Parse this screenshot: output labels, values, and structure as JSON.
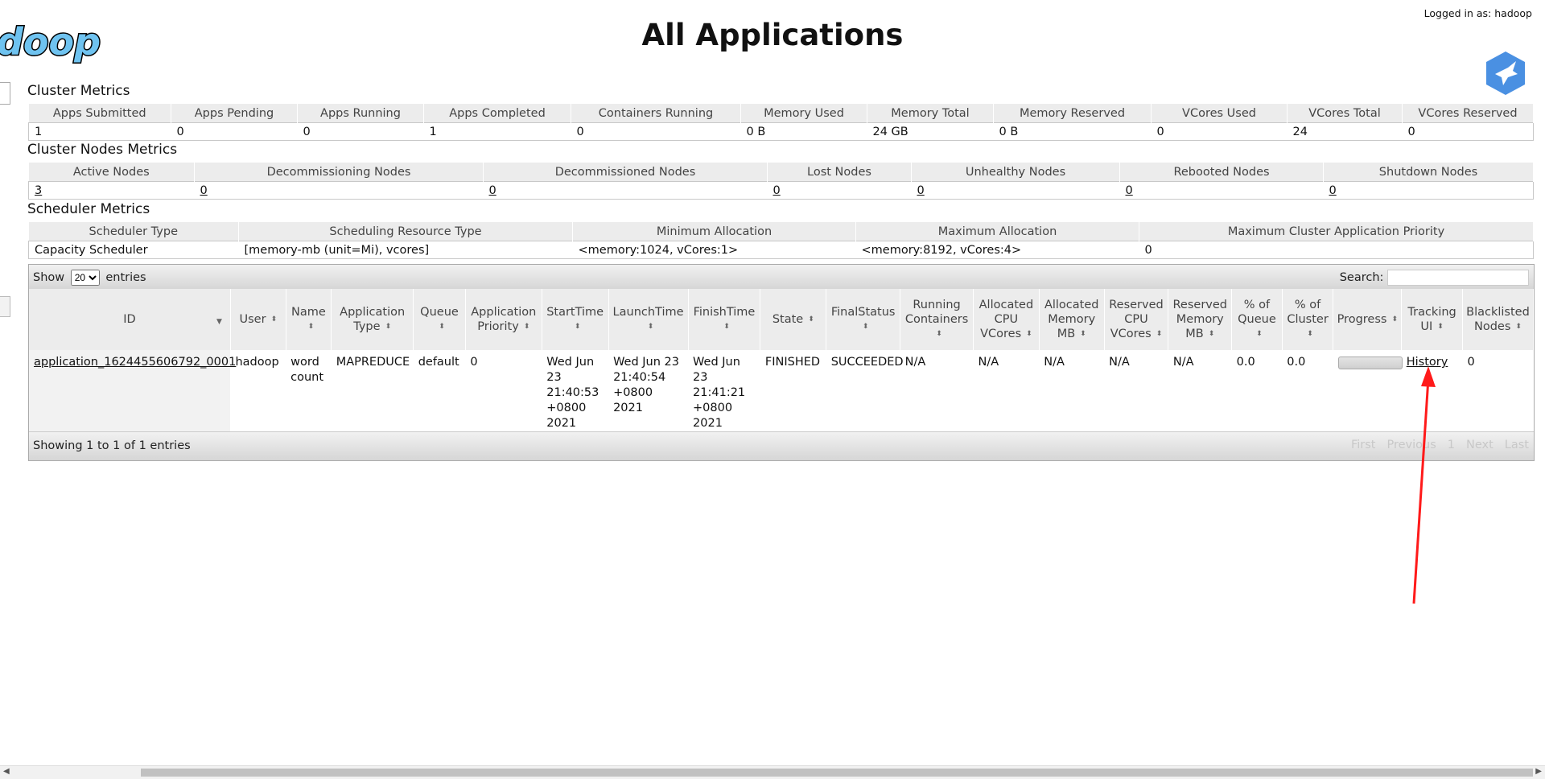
{
  "header": {
    "logo_text": "doop",
    "title": "All Applications",
    "logged_in": "Logged in as: hadoop"
  },
  "cluster_metrics": {
    "title": "Cluster Metrics",
    "headers": [
      "Apps Submitted",
      "Apps Pending",
      "Apps Running",
      "Apps Completed",
      "Containers Running",
      "Memory Used",
      "Memory Total",
      "Memory Reserved",
      "VCores Used",
      "VCores Total",
      "VCores Reserved"
    ],
    "values": [
      "1",
      "0",
      "0",
      "1",
      "0",
      "0 B",
      "24 GB",
      "0 B",
      "0",
      "24",
      "0"
    ]
  },
  "node_metrics": {
    "title": "Cluster Nodes Metrics",
    "headers": [
      "Active Nodes",
      "Decommissioning Nodes",
      "Decommissioned Nodes",
      "Lost Nodes",
      "Unhealthy Nodes",
      "Rebooted Nodes",
      "Shutdown Nodes"
    ],
    "values": [
      "3",
      "0",
      "0",
      "0",
      "0",
      "0",
      "0"
    ]
  },
  "scheduler_metrics": {
    "title": "Scheduler Metrics",
    "headers": [
      "Scheduler Type",
      "Scheduling Resource Type",
      "Minimum Allocation",
      "Maximum Allocation",
      "Maximum Cluster Application Priority"
    ],
    "values": [
      "Capacity Scheduler",
      "[memory-mb (unit=Mi), vcores]",
      "<memory:1024, vCores:1>",
      "<memory:8192, vCores:4>",
      "0"
    ]
  },
  "apps_table": {
    "show_label": "Show",
    "entries_label": "entries",
    "page_size": "20",
    "search_label": "Search:",
    "headers": [
      "ID",
      "User",
      "Name",
      "Application Type",
      "Queue",
      "Application Priority",
      "StartTime",
      "LaunchTime",
      "FinishTime",
      "State",
      "FinalStatus",
      "Running Containers",
      "Allocated CPU VCores",
      "Allocated Memory MB",
      "Reserved CPU VCores",
      "Reserved Memory MB",
      "% of Queue",
      "% of Cluster",
      "Progress",
      "Tracking UI",
      "Blacklisted Nodes"
    ],
    "row": {
      "id": "application_1624455606792_0001",
      "user": "hadoop",
      "name": "word count",
      "type": "MAPREDUCE",
      "queue": "default",
      "priority": "0",
      "start": "Wed Jun 23 21:40:53 +0800 2021",
      "launch": "Wed Jun 23 21:40:54 +0800 2021",
      "finish": "Wed Jun 23 21:41:21 +0800 2021",
      "state": "FINISHED",
      "final_status": "SUCCEEDED",
      "running_containers": "N/A",
      "alloc_vcores": "N/A",
      "alloc_mem": "N/A",
      "res_vcores": "N/A",
      "res_mem": "N/A",
      "pct_queue": "0.0",
      "pct_cluster": "0.0",
      "progress": 0,
      "tracking": "History",
      "blacklisted": "0"
    },
    "info": "Showing 1 to 1 of 1 entries",
    "pager": [
      "First",
      "Previous",
      "1",
      "Next",
      "Last"
    ]
  }
}
